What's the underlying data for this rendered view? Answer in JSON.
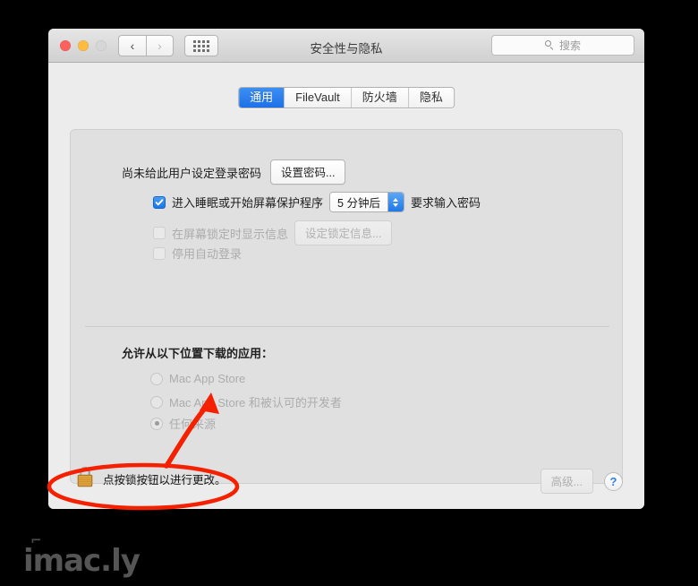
{
  "window": {
    "title": "安全性与隐私",
    "traffic_lights": [
      "close",
      "minimize",
      "zoom"
    ],
    "nav": {
      "back": "‹",
      "forward": "›"
    },
    "show_all_icon": "grid-icon"
  },
  "search": {
    "placeholder": "搜索",
    "icon": "search-icon"
  },
  "tabs": [
    {
      "label": "通用",
      "active": true
    },
    {
      "label": "FileVault",
      "active": false
    },
    {
      "label": "防火墙",
      "active": false
    },
    {
      "label": "隐私",
      "active": false
    }
  ],
  "general": {
    "password_status": "尚未给此用户设定登录密码",
    "set_password_button": "设置密码...",
    "require_password": {
      "checked": true,
      "prefix": "进入睡眠或开始屏幕保护程序",
      "delay_value": "5 分钟后",
      "suffix": "要求输入密码"
    },
    "show_lock_message": {
      "checked": false,
      "enabled": false,
      "label": "在屏幕锁定时显示信息",
      "button": "设定锁定信息..."
    },
    "disable_auto_login": {
      "checked": false,
      "enabled": false,
      "label": "停用自动登录"
    }
  },
  "download_section": {
    "heading": "允许从以下位置下载的应用：",
    "options": [
      {
        "label": "Mac App Store",
        "selected": false
      },
      {
        "label": "Mac App Store 和被认可的开发者",
        "selected": false
      },
      {
        "label": "任何来源",
        "selected": true
      }
    ]
  },
  "footer": {
    "lock_icon": "padlock-closed-icon",
    "lock_message": "点按锁按钮以进行更改。",
    "advanced_button": "高级...",
    "help_button": "?"
  },
  "annotation": {
    "ellipse_color": "#f42000",
    "arrow_color": "#f42000",
    "target": "任何来源"
  },
  "watermark": {
    "text": "imac.ly"
  },
  "colors": {
    "accent_blue": "#1e77e8",
    "window_bg": "#ececec",
    "content_bg": "#e0e0e0",
    "annotation_red": "#f42000"
  }
}
